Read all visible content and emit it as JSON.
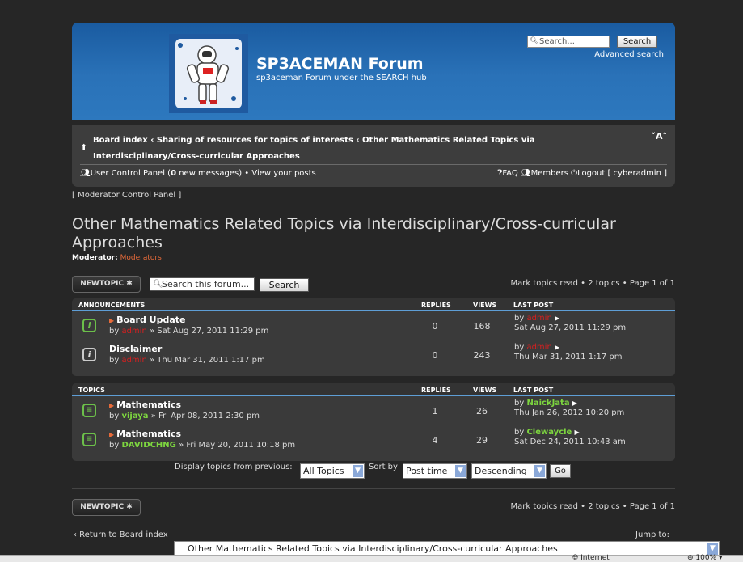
{
  "header": {
    "site_title": "SP3ACEMAN Forum",
    "site_desc": "sp3aceman Forum under the SEARCH hub",
    "search_placeholder": "Search...",
    "search_button": "Search",
    "advanced_search": "Advanced search"
  },
  "nav": {
    "breadcrumb_line1": "Board index ‹ Sharing of resources for topics of interests ‹ Other Mathematics Related Topics via",
    "breadcrumb_line2": "Interdisciplinary/Cross-curricular Approaches",
    "font_size_toggle": "˅A˄",
    "ucp_label": "User Control Panel (",
    "new_messages_count": "0",
    "ucp_suffix": " new messages) • View your posts",
    "faq": "FAQ",
    "members": "Members",
    "logout": "Logout [ cyberadmin ]"
  },
  "moderator_cp": "[ Moderator Control Panel ]",
  "forum": {
    "title": "Other Mathematics Related Topics via Interdisciplinary/Cross-curricular Approaches",
    "moderator_label": "Moderator:",
    "moderator_value": "Moderators"
  },
  "actions": {
    "new_topic": "NEWTOPIC ✱",
    "search_forum_placeholder": "Search this forum...",
    "search_button": "Search",
    "pagination": "Mark topics read • 2 topics • Page 1 of 1"
  },
  "announcements": {
    "header": {
      "title": "ANNOUNCEMENTS",
      "replies": "REPLIES",
      "views": "VIEWS",
      "last_post": "LAST POST"
    },
    "rows": [
      {
        "title": "Board Update",
        "by": "by",
        "author": "admin",
        "date": "» Sat Aug 27, 2011 11:29 pm",
        "replies": "0",
        "views": "168",
        "lp_by": "by",
        "lp_author": "admin",
        "lp_date": "Sat Aug 27, 2011 11:29 pm"
      },
      {
        "title": "Disclaimer",
        "by": "by",
        "author": "admin",
        "date": "» Thu Mar 31, 2011 1:17 pm",
        "replies": "0",
        "views": "243",
        "lp_by": "by",
        "lp_author": "admin",
        "lp_date": "Thu Mar 31, 2011 1:17 pm"
      }
    ]
  },
  "topics": {
    "header": {
      "title": "TOPICS",
      "replies": "REPLIES",
      "views": "VIEWS",
      "last_post": "LAST POST"
    },
    "rows": [
      {
        "title": "Mathematics",
        "by": "by",
        "author": "vijaya",
        "date": "» Fri Apr 08, 2011 2:30 pm",
        "replies": "1",
        "views": "26",
        "lp_by": "by",
        "lp_author": "NaickJata",
        "lp_date": "Thu Jan 26, 2012 10:20 pm"
      },
      {
        "title": "Mathematics",
        "by": "by",
        "author": "DAVIDCHNG",
        "date": "» Fri May 20, 2011 10:18 pm",
        "replies": "4",
        "views": "29",
        "lp_by": "by",
        "lp_author": "Clewaycle",
        "lp_date": "Sat Dec 24, 2011 10:43 am"
      }
    ]
  },
  "display": {
    "label": "Display topics from previous:",
    "period": "All Topics",
    "sort_label": "Sort by",
    "sort_key": "Post time",
    "order": "Descending",
    "go": "Go"
  },
  "footer": {
    "return": "‹ Return to Board index",
    "jump_label": "Jump to:",
    "jump_value": "Other Mathematics Related Topics via Interdisciplinary/Cross-curricular Approaches"
  },
  "status_bar": {
    "zone": "Internet",
    "zoom": "100%"
  }
}
